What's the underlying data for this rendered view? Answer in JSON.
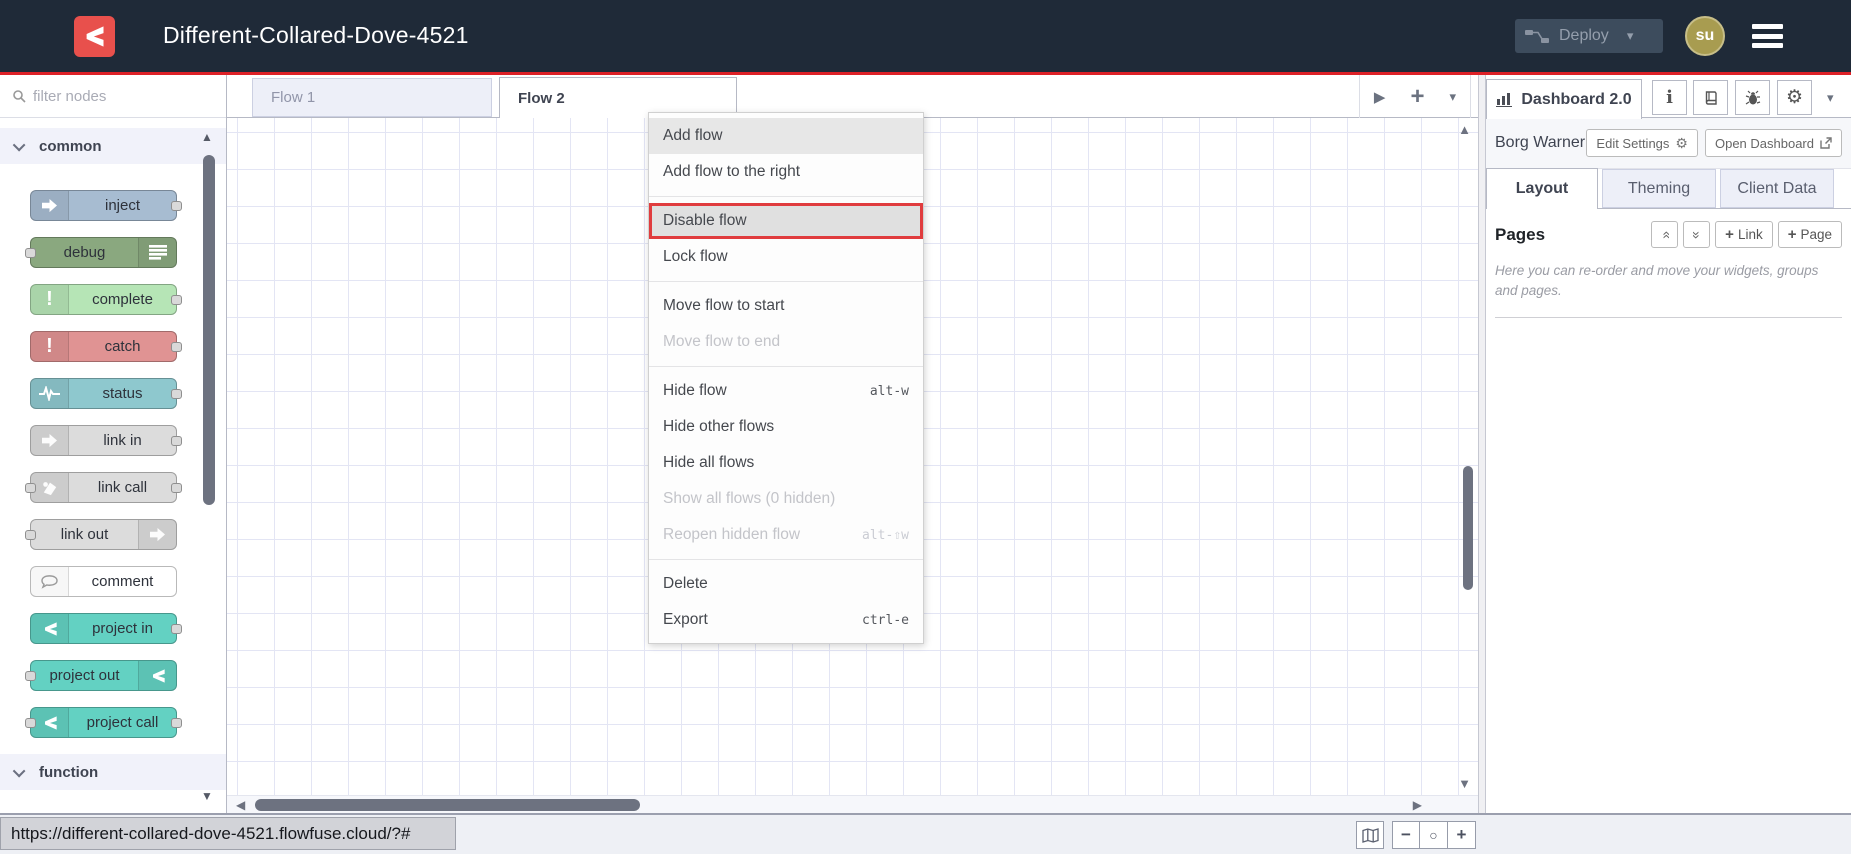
{
  "header": {
    "title": "Different-Collared-Dove-4521",
    "deploy_label": "Deploy",
    "avatar_initials": "su"
  },
  "palette": {
    "search_placeholder": "filter nodes",
    "category_common": "common",
    "category_function": "function",
    "nodes": [
      {
        "label": "inject"
      },
      {
        "label": "debug"
      },
      {
        "label": "complete"
      },
      {
        "label": "catch"
      },
      {
        "label": "status"
      },
      {
        "label": "link in"
      },
      {
        "label": "link call"
      },
      {
        "label": "link out"
      },
      {
        "label": "comment"
      },
      {
        "label": "project in"
      },
      {
        "label": "project out"
      },
      {
        "label": "project call"
      }
    ]
  },
  "workspace": {
    "tabs": [
      {
        "label": "Flow 1"
      },
      {
        "label": "Flow 2"
      }
    ]
  },
  "context_menu": {
    "items": [
      {
        "label": "Add flow"
      },
      {
        "label": "Add flow to the right"
      },
      {
        "label": "Disable flow"
      },
      {
        "label": "Lock flow"
      },
      {
        "label": "Move flow to start"
      },
      {
        "label": "Move flow to end"
      },
      {
        "label": "Hide flow",
        "shortcut": "alt-w"
      },
      {
        "label": "Hide other flows"
      },
      {
        "label": "Hide all flows"
      },
      {
        "label": "Show all flows (0 hidden)"
      },
      {
        "label": "Reopen hidden flow",
        "shortcut": "alt-⇧w"
      },
      {
        "label": "Delete"
      },
      {
        "label": "Export",
        "shortcut": "ctrl-e"
      }
    ]
  },
  "sidebar": {
    "tab_label": "Dashboard 2.0",
    "project_name": "Borg Warner",
    "edit_settings_label": "Edit Settings",
    "open_dashboard_label": "Open Dashboard",
    "tabs": [
      {
        "label": "Layout"
      },
      {
        "label": "Theming"
      },
      {
        "label": "Client Data"
      }
    ],
    "pages": {
      "title": "Pages",
      "add_link_label": "Link",
      "add_page_label": "Page",
      "help_text": "Here you can re-order and move your widgets, groups and pages."
    }
  },
  "statusbar": {
    "url": "https://different-collared-dove-4521.flowfuse.cloud/?#"
  },
  "icons": {
    "gear": "⚙",
    "caret_down": "▾",
    "play": "▶",
    "plus": "+",
    "minus": "−",
    "zoom_reset": "○",
    "scroll_up": "▲",
    "scroll_down": "▼",
    "scroll_left": "◀",
    "scroll_right": "▶",
    "chevron_double": "»",
    "info": "i"
  },
  "colors": {
    "accent_red": "#dd2127",
    "logo_red": "#e8504c",
    "header_bg": "#1f2a38",
    "avatar_bg": "#a89c50",
    "node_inject": "#a7bcd1",
    "node_debug": "#8aa87f",
    "node_complete": "#b6e5b6",
    "node_catch": "#e09393",
    "node_status": "#8ec8ce",
    "node_link": "#dcdcdc",
    "node_project": "#63d1c2",
    "grid_line": "#e3e5f4",
    "menu_highlight_border": "#e03c3e"
  }
}
